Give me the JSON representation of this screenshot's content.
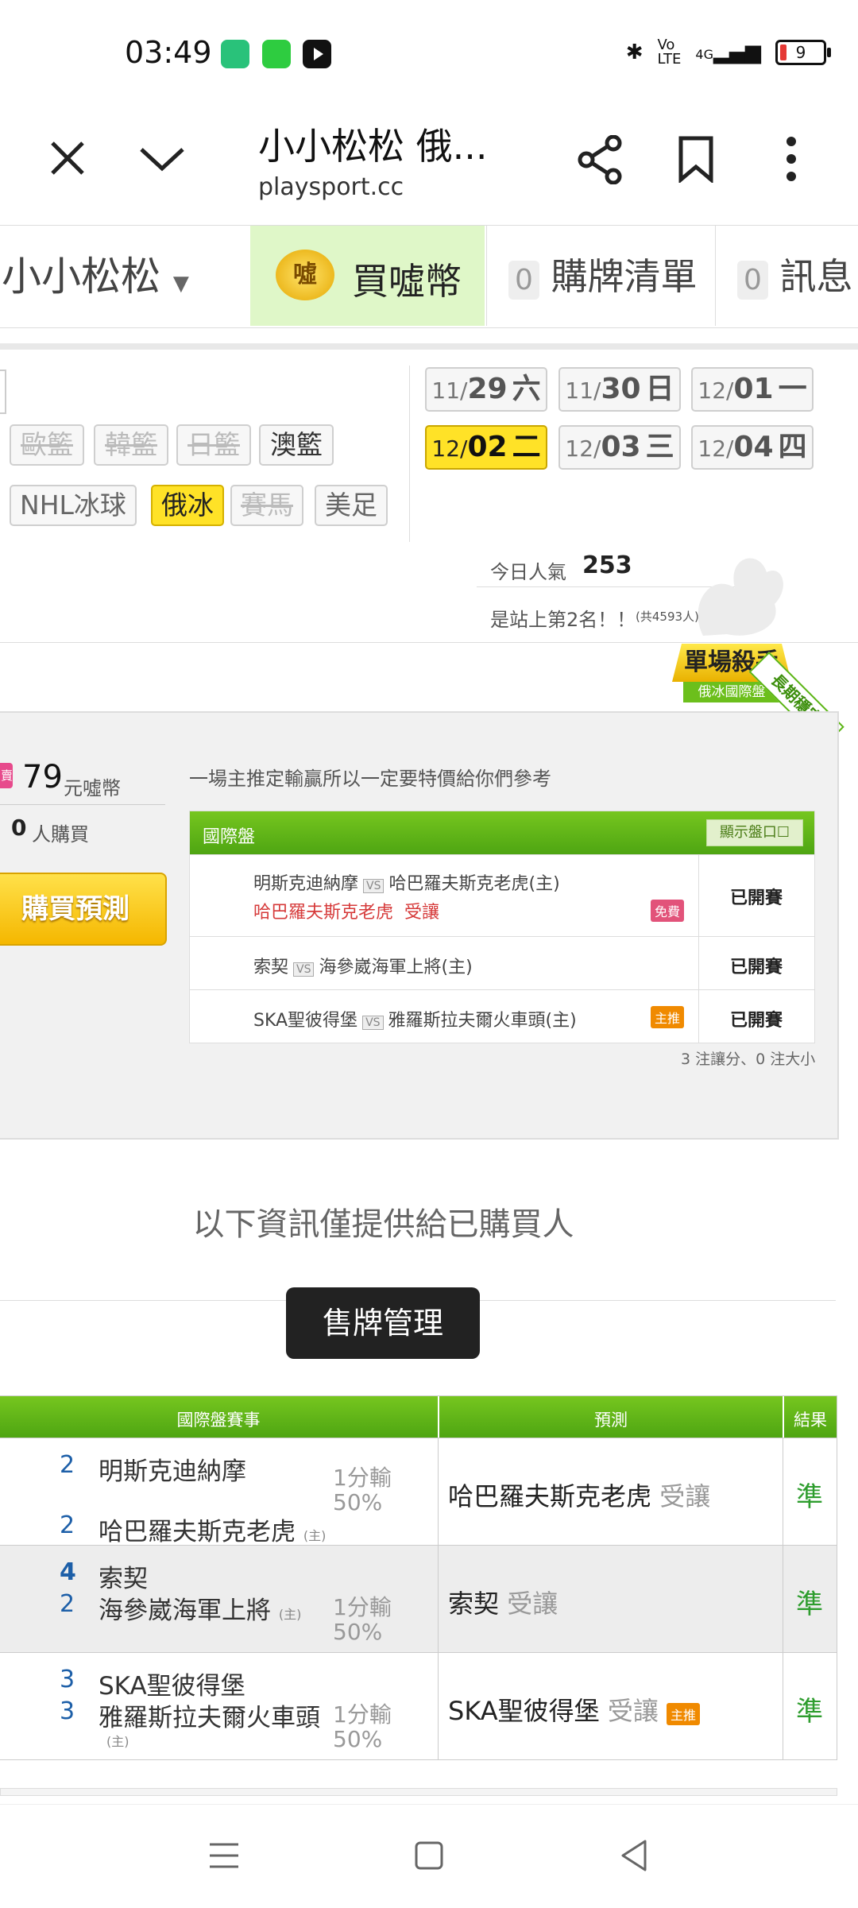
{
  "status_bar": {
    "time": "03:49",
    "battery": "9",
    "network": "4G"
  },
  "browser": {
    "title": "小小松松 俄...",
    "url": "playsport.cc"
  },
  "nav": {
    "user": "小小松松",
    "buy_label": "買噓幣",
    "list_count": "0",
    "list_label": "購牌清單",
    "msg_count": "0",
    "msg_label": "訊息",
    "coin_badge": "噓"
  },
  "sports_row1": [
    "歐籃",
    "韓籃",
    "日籃",
    "澳籃"
  ],
  "sports_row2": [
    "NHL冰球",
    "俄冰",
    "賽馬",
    "美足"
  ],
  "dates": [
    {
      "md": "11/",
      "d": "29",
      "w": "六"
    },
    {
      "md": "11/",
      "d": "30",
      "w": "日"
    },
    {
      "md": "12/",
      "d": "01",
      "w": "一"
    },
    {
      "md": "12/",
      "d": "02",
      "w": "二"
    },
    {
      "md": "12/",
      "d": "03",
      "w": "三"
    },
    {
      "md": "12/",
      "d": "04",
      "w": "四"
    }
  ],
  "popularity": {
    "label": "今日人氣",
    "value": "253",
    "rank_text": "是站上第2名！！",
    "total": "(共4593人)"
  },
  "badge": {
    "title": "單場殺手",
    "subtitle": "俄冰國際盤",
    "ribbon": "長期穩定"
  },
  "offer": {
    "price": "79",
    "price_unit": "元噓幣",
    "buyers": "0",
    "buyers_unit": "人購買",
    "buy_button": "購買預測",
    "price_tag": "賣"
  },
  "intro": "一場主推定輸贏所以一定要特價給你們參考",
  "pick_table": {
    "header": "國際盤",
    "toggle": "顯示盤口",
    "rows": [
      {
        "away": "明斯克迪納摩",
        "home": "哈巴羅夫斯克老虎(主)",
        "pick_team": "哈巴羅夫斯克老虎",
        "pick_type": "受讓",
        "tag": "免費",
        "status": "已開賽"
      },
      {
        "away": "索契",
        "home": "海參崴海軍上將(主)",
        "pick_team": "",
        "pick_type": "",
        "tag": "",
        "status": "已開賽"
      },
      {
        "away": "SKA聖彼得堡",
        "home": "雅羅斯拉夫爾火車頭(主)",
        "pick_team": "",
        "pick_type": "",
        "tag": "主推",
        "status": "已開賽"
      }
    ],
    "summary": "3 注讓分、0 注大小",
    "vs": "VS"
  },
  "notice": "以下資訊僅提供給已購買人",
  "manage_button": "售牌管理",
  "results": {
    "headers": [
      "國際盤賽事",
      "預測",
      "結果"
    ],
    "home_mark": "(主)",
    "rows": [
      {
        "s1": "2",
        "t1": "明斯克迪納摩",
        "s2": "2",
        "t2": "哈巴羅夫斯克老虎",
        "odds1": "1分輸",
        "odds2": "50%",
        "pred": "哈巴羅夫斯克老虎",
        "ptype": "受讓",
        "tag": "",
        "result": "準"
      },
      {
        "s1": "4",
        "t1": "索契",
        "s2": "2",
        "t2": "海參崴海軍上將",
        "odds1": "1分輸",
        "odds2": "50%",
        "pred": "索契",
        "ptype": "受讓",
        "tag": "",
        "result": "準"
      },
      {
        "s1": "3",
        "t1": "SKA聖彼得堡",
        "s2": "3",
        "t2": "雅羅斯拉夫爾火車頭",
        "odds1": "1分輸",
        "odds2": "50%",
        "pred": "SKA聖彼得堡",
        "ptype": "受讓",
        "tag": "主推",
        "result": "準"
      }
    ]
  },
  "colors": {
    "accent_green": "#5cb516",
    "yellow": "#ffe227",
    "red_pick": "#d63a3a"
  }
}
